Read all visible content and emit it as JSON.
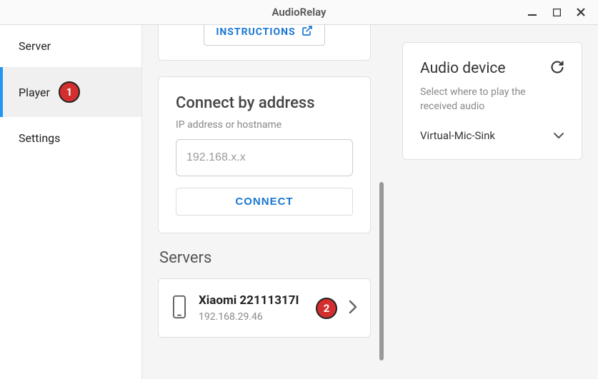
{
  "titlebar": {
    "title": "AudioRelay"
  },
  "sidebar": {
    "items": [
      {
        "label": "Server"
      },
      {
        "label": "Player",
        "badge": "1"
      },
      {
        "label": "Settings"
      }
    ]
  },
  "instructions": {
    "label": "INSTRUCTIONS"
  },
  "connect": {
    "title": "Connect by address",
    "field_label": "IP address or hostname",
    "placeholder": "192.168.x.x",
    "button": "CONNECT"
  },
  "servers": {
    "title": "Servers",
    "list": [
      {
        "name": "Xiaomi 22111317I",
        "ip": "192.168.29.46",
        "badge": "2"
      }
    ]
  },
  "audio_device": {
    "title": "Audio device",
    "description": "Select where to play the received audio",
    "selected": "Virtual-Mic-Sink"
  }
}
